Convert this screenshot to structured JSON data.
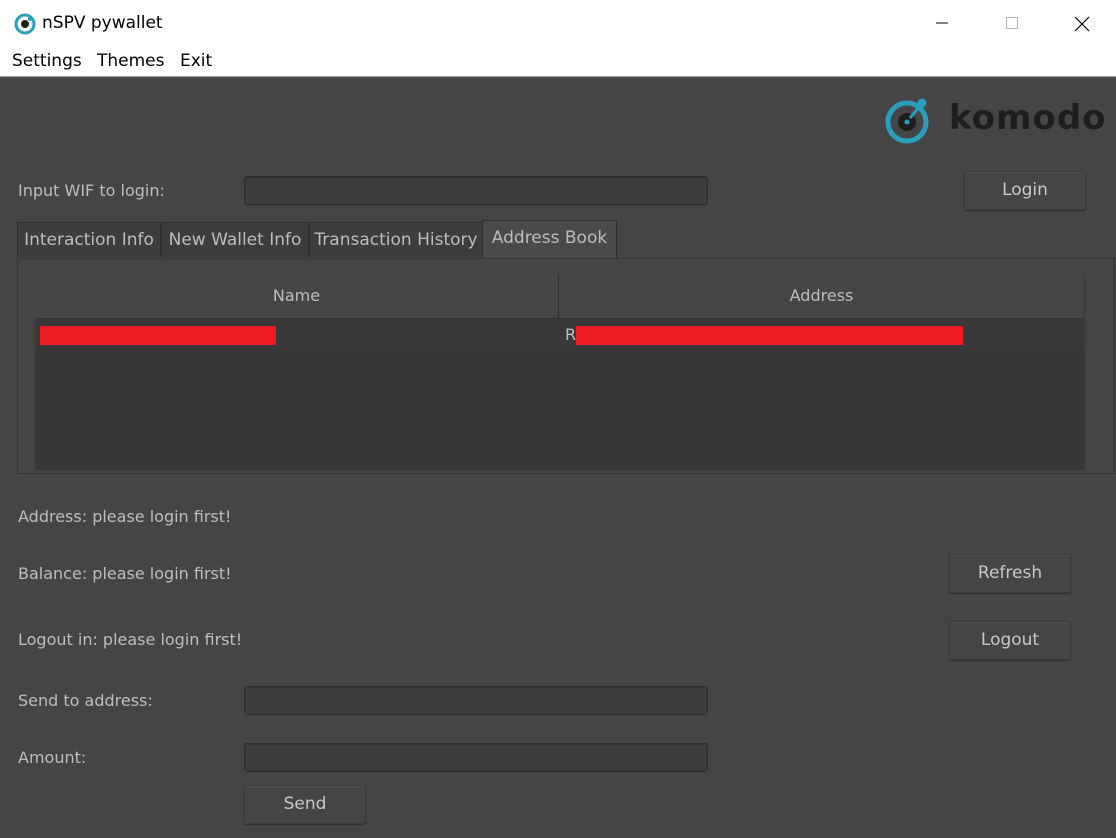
{
  "window": {
    "title": "nSPV pywallet"
  },
  "menu": {
    "settings": "Settings",
    "themes": "Themes",
    "exit": "Exit"
  },
  "brand": {
    "logo_text": "komodo",
    "accent_color": "#2b9ebb",
    "dark_color": "#1e1e1e"
  },
  "login": {
    "wif_label": "Input WIF to login:",
    "wif_value": "",
    "login_button": "Login"
  },
  "tabs": [
    {
      "label": "Interaction Info"
    },
    {
      "label": "New Wallet Info"
    },
    {
      "label": "Transaction History"
    },
    {
      "label": "Address Book",
      "active": true
    }
  ],
  "address_book": {
    "columns": [
      "Name",
      "Address"
    ],
    "rows": [
      {
        "name": "",
        "address_prefix": "R"
      }
    ]
  },
  "status": {
    "address": "Address: please login first!",
    "balance": "Balance: please login first!",
    "logout": "Logout in: please login first!"
  },
  "actions": {
    "refresh_button": "Refresh",
    "logout_button": "Logout",
    "send_button": "Send"
  },
  "send": {
    "to_label": "Send to address:",
    "to_value": "",
    "amount_label": "Amount:",
    "amount_value": ""
  },
  "colors": {
    "background": "#454545",
    "redaction": "#ed1c24"
  }
}
